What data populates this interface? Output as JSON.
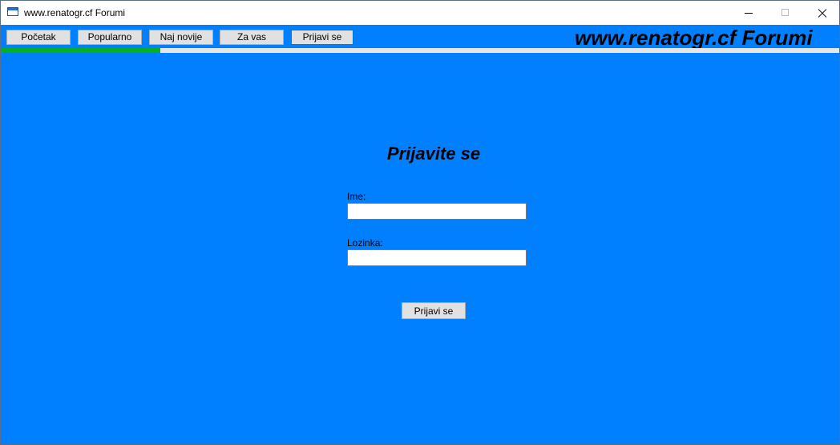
{
  "window": {
    "title": "www.renatogr.cf Forumi",
    "controls": {
      "minimize_icon": "minimize-icon",
      "maximize_icon": "maximize-icon",
      "close_icon": "close-icon"
    }
  },
  "toolbar": {
    "buttons": [
      {
        "label": "Početak"
      },
      {
        "label": "Popularno"
      },
      {
        "label": "Naj novije"
      },
      {
        "label": "Za vas"
      },
      {
        "label": "Prijavi se"
      }
    ],
    "site_title": "www.renatogr.cf Forumi",
    "progress_fraction": 0.19
  },
  "login": {
    "heading": "Prijavite se",
    "username_label": "Ime:",
    "username_value": "",
    "password_label": "Lozinka:",
    "password_value": "",
    "submit_label": "Prijavi se"
  },
  "colors": {
    "background": "#0080ff",
    "progress": "#06b025",
    "button_face": "#e1e1e1"
  }
}
